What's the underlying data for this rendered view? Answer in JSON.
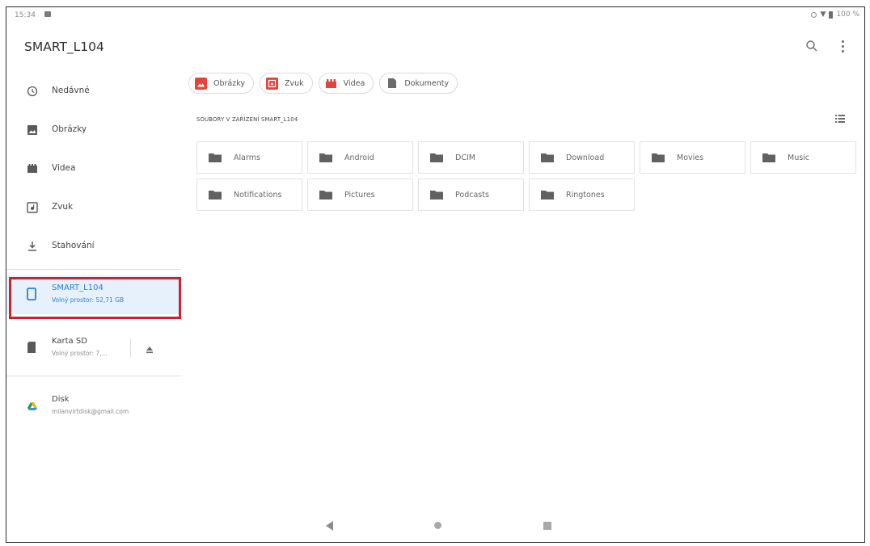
{
  "status_bar": {
    "time": "15:34",
    "battery": "100 %"
  },
  "app_title": "SMART_L104",
  "nav": [
    {
      "label": "Nedávné",
      "icon": "clock-icon"
    },
    {
      "label": "Obrázky",
      "icon": "image-icon"
    },
    {
      "label": "Videa",
      "icon": "video-icon"
    },
    {
      "label": "Zvuk",
      "icon": "audio-icon"
    },
    {
      "label": "Stahování",
      "icon": "download-icon"
    }
  ],
  "storage": [
    {
      "title": "SMART_L104",
      "subtitle": "Volný prostor: 52,71 GB",
      "icon": "phone-icon",
      "active": true
    },
    {
      "title": "Karta SD",
      "subtitle": "Volný prostor: 7,...",
      "icon": "sd-card-icon",
      "active": false
    },
    {
      "title": "Disk",
      "subtitle": "milanvirtdisk@gmail.com",
      "icon": "drive-icon",
      "active": false
    }
  ],
  "chips": [
    {
      "label": "Obrázky",
      "icon": "image-icon",
      "color": "#e5443b"
    },
    {
      "label": "Zvuk",
      "icon": "audio-icon",
      "color": "#e5443b"
    },
    {
      "label": "Videa",
      "icon": "video-icon",
      "color": "#e5443b"
    },
    {
      "label": "Dokumenty",
      "icon": "document-icon",
      "color": "#6b6b6b"
    }
  ],
  "section_title": "SOUBORY V ZAŘÍZENÍ SMART_L104",
  "folders": [
    "Alarms",
    "Android",
    "DCIM",
    "Download",
    "Movies",
    "Music",
    "Notifications",
    "Pictures",
    "Podcasts",
    "Ringtones"
  ],
  "colors": {
    "accent": "#2f7fce",
    "highlight": "#d02030",
    "active_bg": "#e6f1fb",
    "chip_red": "#e5443b"
  }
}
